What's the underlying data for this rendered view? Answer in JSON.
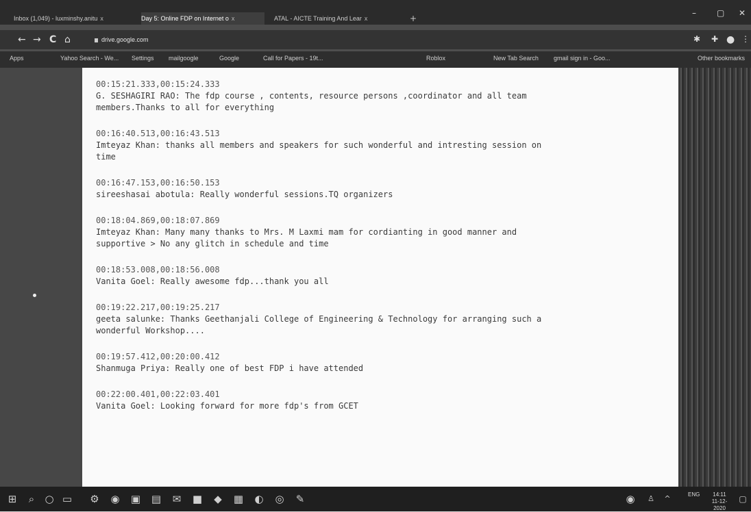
{
  "browser": {
    "tabs": [
      {
        "label": "Inbox (1,049) - luxminshy.anitu",
        "close": "x"
      },
      {
        "label": "Day 5: Online FDP on Internet o",
        "close": "x"
      },
      {
        "label": "ATAL - AICTE Training And Lear",
        "close": "x"
      }
    ],
    "new_tab": "+",
    "window_controls": {
      "minimize": "–",
      "maximize": "▢",
      "close": "✕"
    },
    "nav": {
      "back": "←",
      "forward": "→",
      "reload": "C",
      "home": "⌂"
    },
    "address": "drive.google.com",
    "bookmarks": [
      "Apps",
      "Yahoo Search - We...",
      "Settings",
      "mailgoogle",
      "Google",
      "Call for Papers - 19t...",
      "Roblox",
      "New Tab Search",
      "gmail sign in - Goo...",
      "Other bookmarks"
    ]
  },
  "transcript": [
    {
      "time": "00:15:21.333,00:15:24.333",
      "text": "G. SESHAGIRI RAO: The fdp course , contents, resource persons ,coordinator and all team\nmembers.Thanks to all for everything"
    },
    {
      "time": "00:16:40.513,00:16:43.513",
      "text": "Imteyaz Khan: thanks all members and speakers for such wonderful and intresting session on\ntime"
    },
    {
      "time": "00:16:47.153,00:16:50.153",
      "text": "sireeshasai abotula: Really wonderful sessions.TQ organizers"
    },
    {
      "time": "00:18:04.869,00:18:07.869",
      "text": "Imteyaz Khan: Many many thanks to Mrs. M Laxmi mam for cordianting in good manner and\nsupportive > No any glitch in schedule and time"
    },
    {
      "time": "00:18:53.008,00:18:56.008",
      "text": "Vanita Goel: Really awesome fdp...thank you all"
    },
    {
      "time": "00:19:22.217,00:19:25.217",
      "text": "geeta salunke: Thanks Geethanjali College of Engineering & Technology for arranging such a\nwonderful Workshop...."
    },
    {
      "time": "00:19:57.412,00:20:00.412",
      "text": "Shanmuga Priya: Really one of best FDP i have attended"
    },
    {
      "time": "00:22:00.401,00:22:03.401",
      "text": "Vanita Goel: Looking forward for more fdp's from GCET"
    }
  ],
  "taskbar": {
    "tray_lang": "ENG",
    "tray_time": "14:11",
    "tray_date": "11-12-2020"
  }
}
